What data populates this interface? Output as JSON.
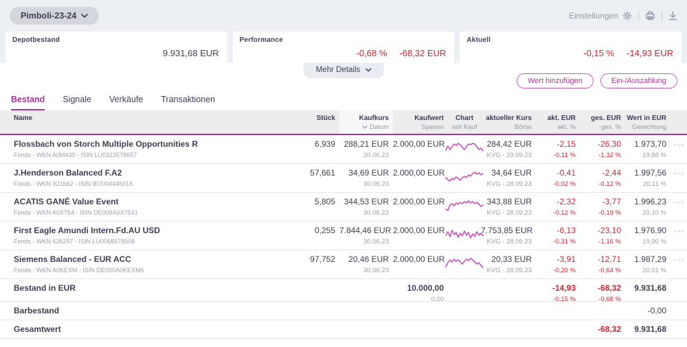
{
  "topbar": {
    "portfolio_name": "Pimboli-23-24",
    "settings_label": "Einstellungen"
  },
  "summary": {
    "depotbestand": {
      "label": "Depotbestand",
      "value": "9.931,68 EUR"
    },
    "performance": {
      "label": "Performance",
      "percent": "-0,68 %",
      "value": "-68,32 EUR"
    },
    "aktuell": {
      "label": "Aktuell",
      "percent": "-0,15 %",
      "value": "-14,93 EUR"
    }
  },
  "mehr_details_label": "Mehr Details",
  "actions": {
    "add_value": "Wert hinzufügen",
    "deposit_withdrawal": "Ein-/Auszahlung"
  },
  "tabs": {
    "bestand": "Bestand",
    "signale": "Signale",
    "verkaeufe": "Verkäufe",
    "transaktionen": "Transaktionen"
  },
  "table": {
    "columns": {
      "name": "Name",
      "stueck": "Stück",
      "kaufkurs": "Kaufkurs",
      "kaufkurs_sub": "Datum",
      "kaufwert": "Kaufwert",
      "kaufwert_sub": "Spesen",
      "chart": "Chart",
      "chart_sub": "seit Kauf",
      "kurs": "aktueller Kurs",
      "kurs_sub": "Börse",
      "akt": "akt. EUR",
      "akt_sub": "akt. %",
      "ges": "ges. EUR",
      "ges_sub": "ges. %",
      "wert": "Wert in EUR",
      "wert_sub": "Gewichtung"
    },
    "row_menu_glyph": "···",
    "rows": [
      {
        "name": "Flossbach von Storch Multiple Opportunities R",
        "details": "Fonds - WKN A0M430 - ISIN LU0323578657",
        "stueck": "6,939",
        "kaufkurs": "288,21 EUR",
        "kaufdatum": "30.06.23",
        "kaufwert": "2.000,00 EUR",
        "kurs": "284,42 EUR",
        "kursquelle": "KVG - 29.09.23",
        "akt": "-2,15",
        "akt_pct": "-0,11 %",
        "ges": "-26,30",
        "ges_pct": "-1,32 %",
        "wert": "1.973,70",
        "gewichtung": "19,88 %",
        "spark": "1,14 4,8 7,13 10,9 13,5 16,7 19,4 22,6 25,10 28,13 31,9 34,5 37,6 40,4 43,5 46,9 49,13 52,11 55,15"
      },
      {
        "name": "J.Henderson Balanced F.A2",
        "details": "Fonds - WKN 921662 - ISIN IE0004445015",
        "stueck": "57,661",
        "kaufkurs": "34,69 EUR",
        "kaufdatum": "30.06.23",
        "kaufwert": "2.000,00 EUR",
        "kurs": "34,64 EUR",
        "kursquelle": "KVG - 28.09.23",
        "akt": "-0,41",
        "akt_pct": "-0,02 %",
        "ges": "-2,44",
        "ges_pct": "-0,12 %",
        "wert": "1.997,56",
        "gewichtung": "20,11 %",
        "spark": "1,12 4,15 7,17 10,13 13,15 16,11 19,13 22,16 25,12 28,10 31,12 34,8 37,10 40,6 43,4 46,7 49,5 52,8 55,6"
      },
      {
        "name": "ACATIS GANÉ Value Event",
        "details": "Fonds - WKN A0X754 - ISIN DE000A0X7541",
        "stueck": "5,805",
        "kaufkurs": "344,53 EUR",
        "kaufdatum": "30.06.23",
        "kaufwert": "2.000,00 EUR",
        "kurs": "343,88 EUR",
        "kursquelle": "KVG - 28.09.23",
        "akt": "-2,32",
        "akt_pct": "-0,12 %",
        "ges": "-3,77",
        "ges_pct": "-0,19 %",
        "wert": "1.996,23",
        "gewichtung": "20,10 %",
        "spark": "1,16 4,18 7,10 10,8 13,11 16,7 19,9 22,6 25,8 28,5 31,7 34,4 37,7 40,5 43,8 46,6 49,9 52,12 55,10"
      },
      {
        "name": "First Eagle Amundi Intern.Fd.AU USD",
        "details": "Fonds - WKN 635297 - ISIN LU0068578508",
        "stueck": "0,255",
        "kaufkurs": "7.844,46 EUR",
        "kaufdatum": "30.06.23",
        "kaufwert": "2.000,00 EUR",
        "kurs": "7.753,85 EUR",
        "kursquelle": "KVG - 28.09.23",
        "akt": "-6,13",
        "akt_pct": "-0,31 %",
        "ges": "-23,10",
        "ges_pct": "-1,16 %",
        "wert": "1.976,90",
        "gewichtung": "19,90 %",
        "spark": "1,12 4,7 7,14 10,5 13,11 16,8 19,15 22,9 25,13 28,6 31,12 34,8 37,16 40,10 43,14 46,7 49,12 52,9 55,13"
      },
      {
        "name": "Siemens Balanced - EUR ACC",
        "details": "Fonds - WKN A0KEXM - ISIN DE000A0KEXM6",
        "stueck": "97,752",
        "kaufkurs": "20,46 EUR",
        "kaufdatum": "30.06.23",
        "kaufwert": "2.000,00 EUR",
        "kurs": "20,33 EUR",
        "kursquelle": "KVG - 28.09.23",
        "akt": "-3,91",
        "akt_pct": "-0,20 %",
        "ges": "-12,71",
        "ges_pct": "-0,64 %",
        "wert": "1.987,29",
        "gewichtung": "20,01 %",
        "spark": "1,16 4,10 7,6 10,9 13,5 16,8 19,6 22,9 25,12 28,8 31,5 34,7 37,4 40,6 43,9 46,12 49,10 52,14 55,17"
      }
    ],
    "totals": {
      "bestand": {
        "label": "Bestand in EUR",
        "kaufwert": "10.000,00",
        "spesen": "0,00",
        "akt": "-14,93",
        "akt_pct": "-0,15 %",
        "ges": "-68,32",
        "ges_pct": "-0,68 %",
        "wert": "9.931,68"
      },
      "barbestand": {
        "label": "Barbestand",
        "wert": "-0,00"
      },
      "gesamtwert": {
        "label": "Gesamtwert",
        "ges": "-68,32",
        "wert": "9.931,68"
      }
    }
  }
}
